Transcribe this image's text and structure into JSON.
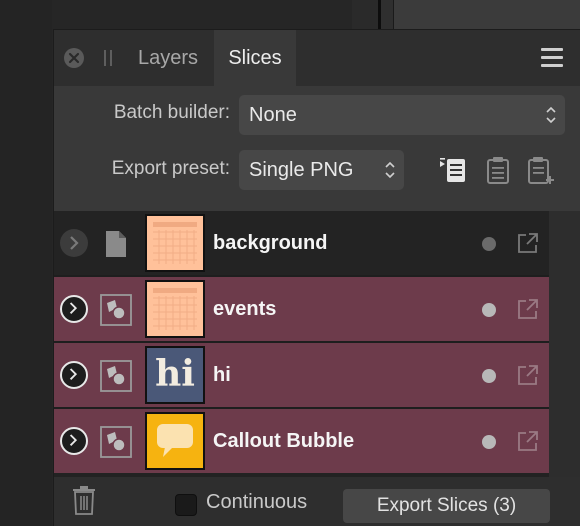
{
  "tabs": [
    {
      "label": "Layers",
      "active": false
    },
    {
      "label": "Slices",
      "active": true
    }
  ],
  "batch_builder": {
    "label": "Batch builder:",
    "value": "None"
  },
  "export_preset": {
    "label": "Export preset:",
    "value": "Single PNG"
  },
  "slices": [
    {
      "label": "background",
      "type": "document",
      "highlighted": false
    },
    {
      "label": "events",
      "type": "layer",
      "highlighted": true
    },
    {
      "label": "hi",
      "type": "layer",
      "highlighted": true,
      "thumb_text": "hi"
    },
    {
      "label": "Callout Bubble",
      "type": "layer",
      "highlighted": true
    }
  ],
  "footer": {
    "continuous_label": "Continuous",
    "continuous_checked": false,
    "export_button": "Export Slices (3)"
  },
  "colors": {
    "highlight_row": "#6d3b4b",
    "thumb_peach": "#ffc19a",
    "thumb_navy": "#4a5878",
    "thumb_yellow": "#f6b310"
  }
}
